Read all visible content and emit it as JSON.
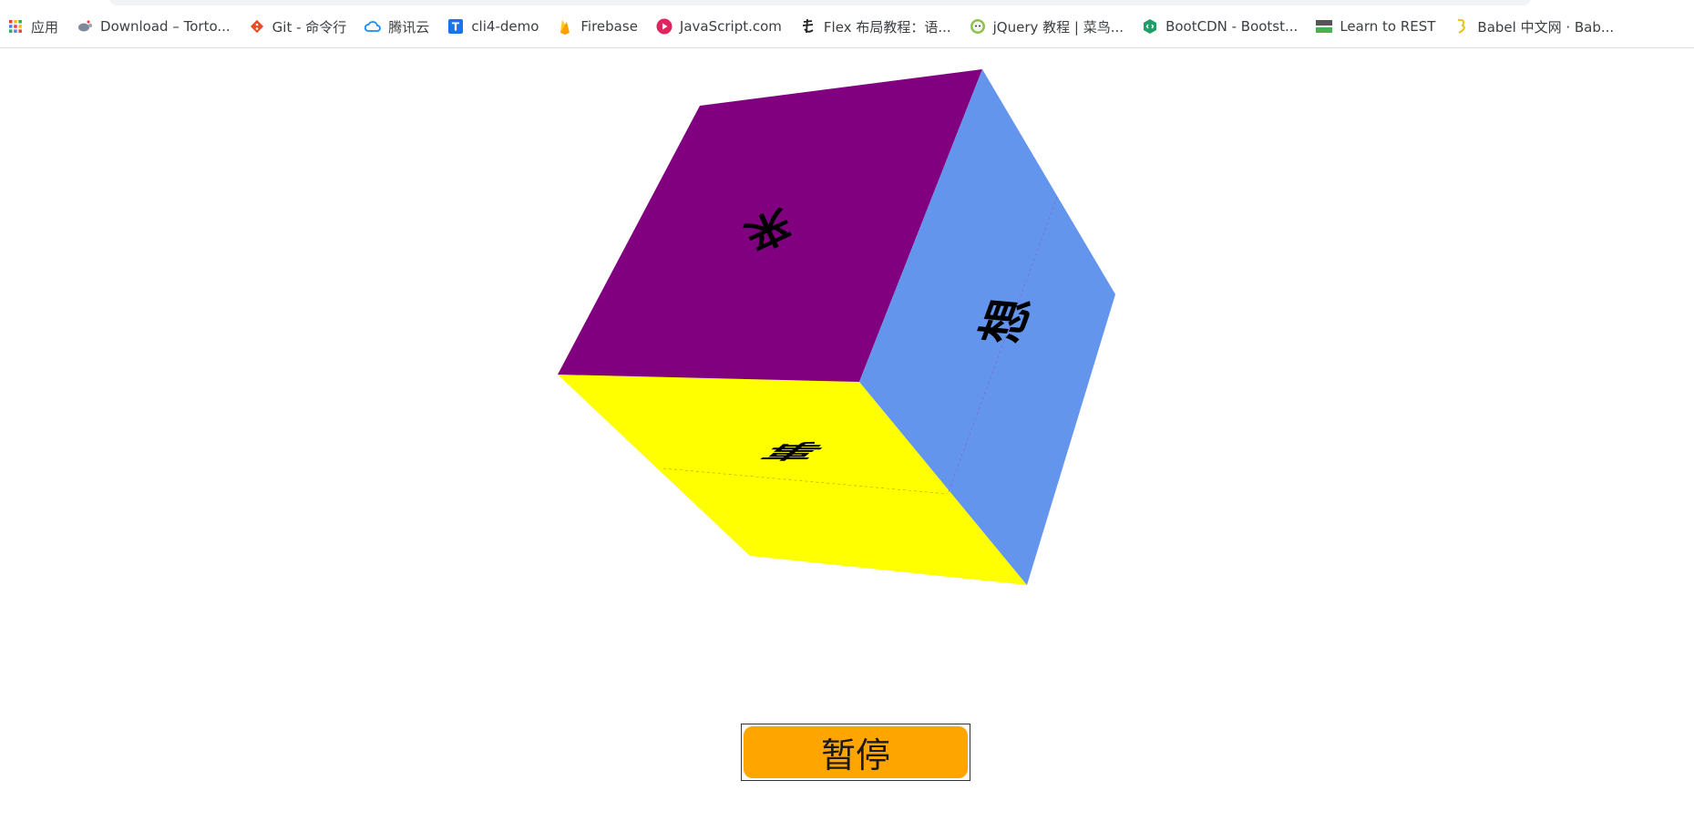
{
  "bookmarks": [
    {
      "label": "应用",
      "icon": "apps-grid-icon",
      "color": "#e94235"
    },
    {
      "label": "Download – Torto...",
      "icon": "tortoise-icon",
      "color": "#7a8a9a"
    },
    {
      "label": "Git - 命令行",
      "icon": "git-icon",
      "color": "#e44d26"
    },
    {
      "label": "腾讯云",
      "icon": "cloud-icon",
      "color": "#1a8bf0"
    },
    {
      "label": "cli4-demo",
      "icon": "t-icon",
      "color": "#1a73e8"
    },
    {
      "label": "Firebase",
      "icon": "firebase-icon",
      "color": "#ffa000"
    },
    {
      "label": "JavaScript.com",
      "icon": "javascript-icon",
      "color": "#e0245e"
    },
    {
      "label": "Flex 布局教程：语...",
      "icon": "calligraphy-icon",
      "color": "#222222"
    },
    {
      "label": "jQuery 教程 | 菜鸟...",
      "icon": "runoob-icon",
      "color": "#8bc34a"
    },
    {
      "label": "BootCDN - Bootst...",
      "icon": "bootcdn-icon",
      "color": "#1e9e6a"
    },
    {
      "label": "Learn to REST",
      "icon": "rest-icon",
      "color": "#4caf50"
    },
    {
      "label": "Babel 中文网 · Bab...",
      "icon": "babel-icon",
      "color": "#e8c21a"
    }
  ],
  "cube": {
    "top_face": {
      "glyph": "来",
      "color": "#800080"
    },
    "right_face": {
      "glyph": "想",
      "color": "#6495ed"
    },
    "bottom_face": {
      "glyph": "事",
      "color": "#ffff00"
    }
  },
  "pause_button": {
    "label": "暂停",
    "color": "#ffa500"
  }
}
